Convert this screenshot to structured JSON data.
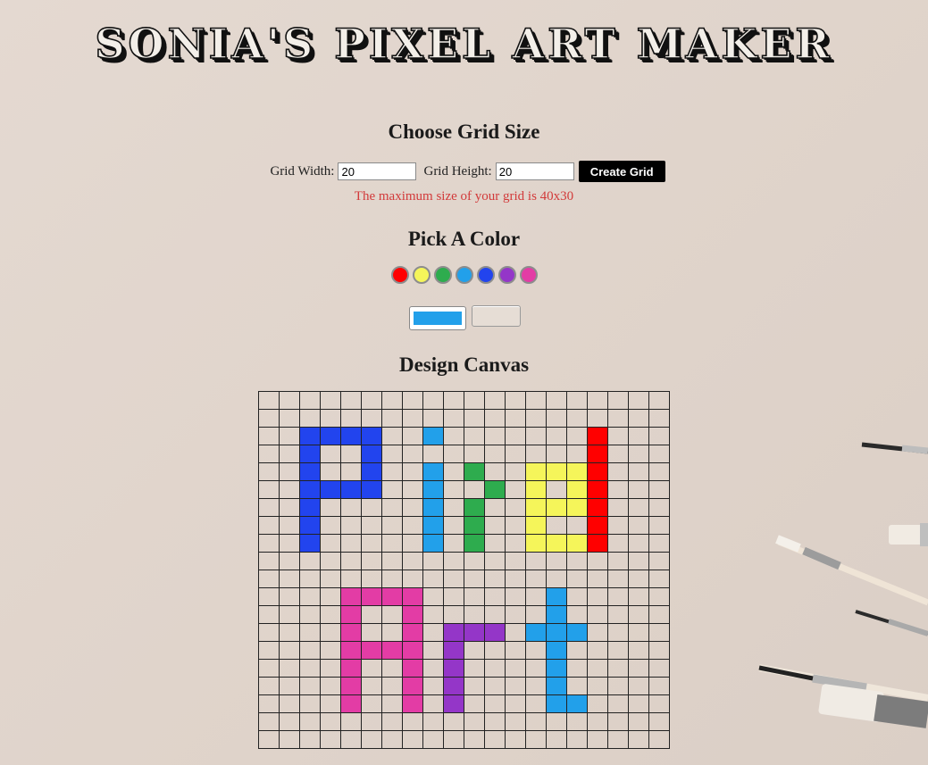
{
  "page": {
    "title": "Sonia's Pixel Art Maker"
  },
  "grid_size": {
    "heading": "Choose Grid Size",
    "width_label": "Grid Width:",
    "width_value": "20",
    "height_label": "Grid Height:",
    "height_value": "20",
    "create_button": "Create Grid",
    "max_note": "The maximum size of your grid is 40x30"
  },
  "color_picker": {
    "heading": "Pick A Color",
    "swatches": [
      {
        "name": "red",
        "color": "#ff0000"
      },
      {
        "name": "yellow",
        "color": "#f5f55a"
      },
      {
        "name": "green",
        "color": "#2eac4e"
      },
      {
        "name": "sky-blue",
        "color": "#22a0ea"
      },
      {
        "name": "blue",
        "color": "#2244ee"
      },
      {
        "name": "purple",
        "color": "#9436c8"
      },
      {
        "name": "pink",
        "color": "#e33ca5"
      }
    ],
    "current_color": "#22a0ea"
  },
  "canvas": {
    "heading": "Design Canvas",
    "columns": 20,
    "rows": 20,
    "palette": {
      "B": "#2244ee",
      "S": "#22a0ea",
      "G": "#2eac4e",
      "Y": "#f5f55a",
      "R": "#ff0000",
      "P": "#e33ca5",
      "V": "#9436c8"
    },
    "pixels": [
      "....................",
      "....................",
      "..BBBB..S.......R...",
      "..B..B..........R...",
      "..B..B..S.G..YYYR...",
      "..BBBB..S..G.Y.YR...",
      "..B.....S.G..YYYR...",
      "..B.....S.G..Y..R...",
      "..B.....S.G..YYYR...",
      "....................",
      "....................",
      "....PPPP......S.....",
      "....P..P......S.....",
      "....P..P.VVV.SSS....",
      "....PPPP.V....S.....",
      "....P..P.V....S.....",
      "....P..P.V....S.....",
      "....P..P.V....SS....",
      "....................",
      "...................."
    ]
  }
}
